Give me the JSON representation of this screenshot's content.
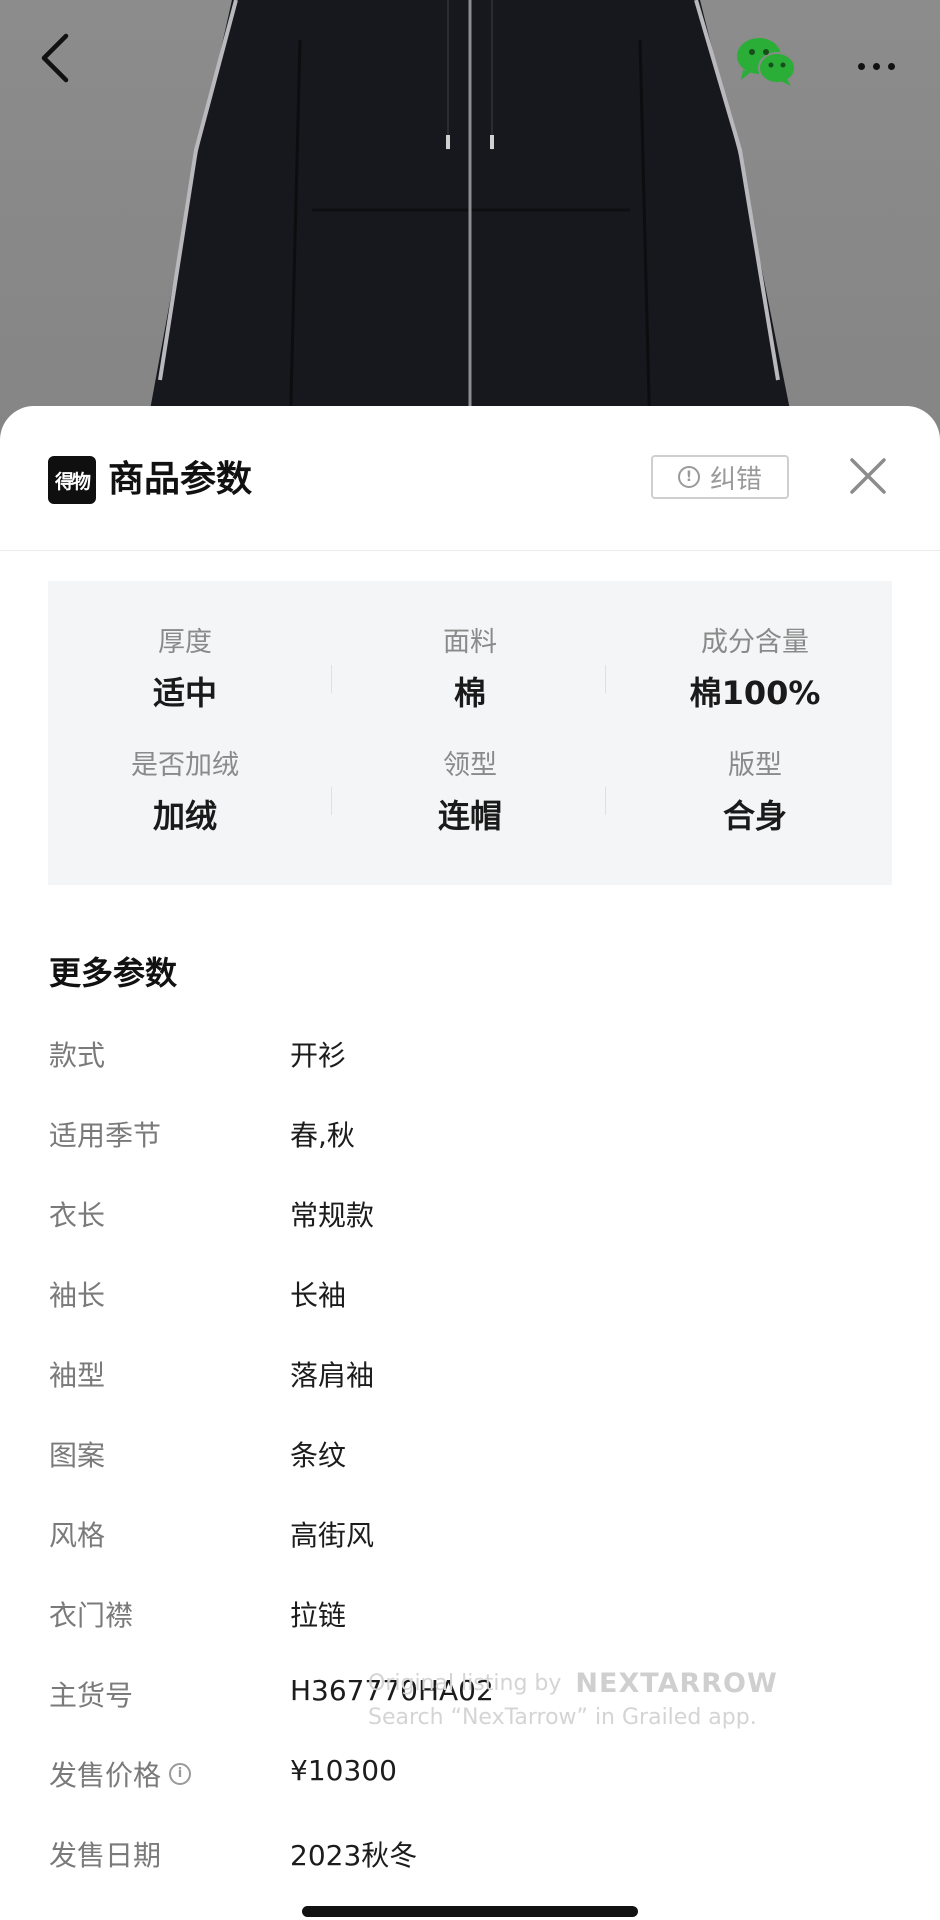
{
  "nav": {
    "back_icon": "chevron-left-icon",
    "share_icon": "wechat-icon",
    "more_icon": "more-dots-icon",
    "wechat_color": "#2aae37"
  },
  "sheet": {
    "logo_text": "得物",
    "title": "商品参数",
    "report_label": "纠错",
    "close_icon": "close-icon"
  },
  "key_params": [
    {
      "label": "厚度",
      "value": "适中"
    },
    {
      "label": "面料",
      "value": "棉"
    },
    {
      "label": "成分含量",
      "value": "棉100%"
    },
    {
      "label": "是否加绒",
      "value": "加绒"
    },
    {
      "label": "领型",
      "value": "连帽"
    },
    {
      "label": "版型",
      "value": "合身"
    }
  ],
  "more_params": {
    "title": "更多参数",
    "rows": [
      {
        "key": "款式",
        "value": "开衫"
      },
      {
        "key": "适用季节",
        "value": "春,秋"
      },
      {
        "key": "衣长",
        "value": "常规款"
      },
      {
        "key": "袖长",
        "value": "长袖"
      },
      {
        "key": "袖型",
        "value": "落肩袖"
      },
      {
        "key": "图案",
        "value": "条纹"
      },
      {
        "key": "风格",
        "value": "高街风"
      },
      {
        "key": "衣门襟",
        "value": "拉链"
      },
      {
        "key": "主货号",
        "value": "H367770HA02"
      },
      {
        "key": "发售价格",
        "value": "¥10300"
      },
      {
        "key": "发售日期",
        "value": "2023秋冬"
      }
    ]
  },
  "watermark": {
    "line1": "Original listing by",
    "brand": "NEXTARROW",
    "line2": "Search “NexTarrow” in Grailed app."
  }
}
